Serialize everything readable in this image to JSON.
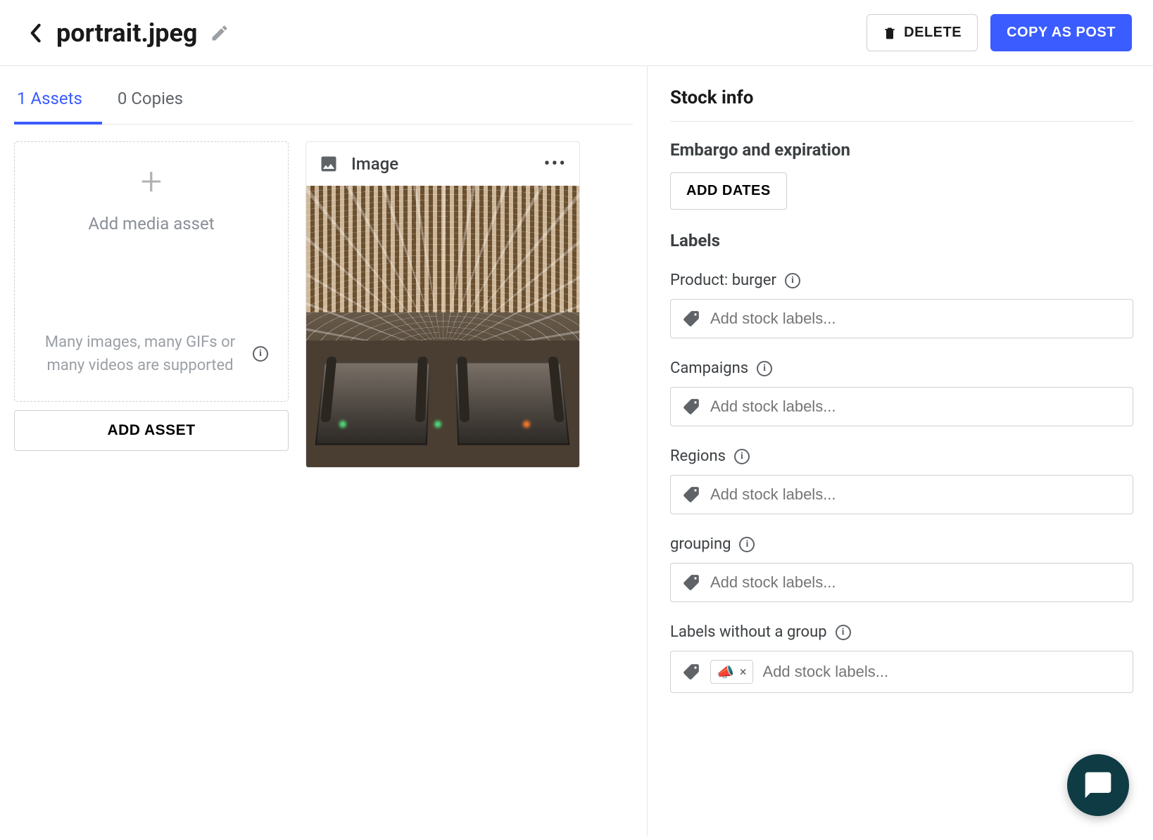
{
  "header": {
    "title": "portrait.jpeg",
    "delete_label": "DELETE",
    "copy_label": "COPY AS POST"
  },
  "tabs": {
    "assets": "1 Assets",
    "copies": "0 Copies"
  },
  "dropzone": {
    "title": "Add media asset",
    "subtitle": "Many images, many GIFs or many videos are supported",
    "add_button": "ADD ASSET"
  },
  "asset_card": {
    "type_label": "Image"
  },
  "sidebar": {
    "title": "Stock info",
    "embargo": {
      "title": "Embargo and expiration",
      "button": "ADD DATES"
    },
    "labels_title": "Labels",
    "fields": {
      "product": {
        "label": "Product: burger",
        "placeholder": "Add stock labels..."
      },
      "campaigns": {
        "label": "Campaigns",
        "placeholder": "Add stock labels..."
      },
      "regions": {
        "label": "Regions",
        "placeholder": "Add stock labels..."
      },
      "grouping": {
        "label": "grouping",
        "placeholder": "Add stock labels..."
      },
      "ungrouped": {
        "label": "Labels without a group",
        "placeholder": "Add stock labels...",
        "chip_emoji": "📣"
      }
    }
  }
}
